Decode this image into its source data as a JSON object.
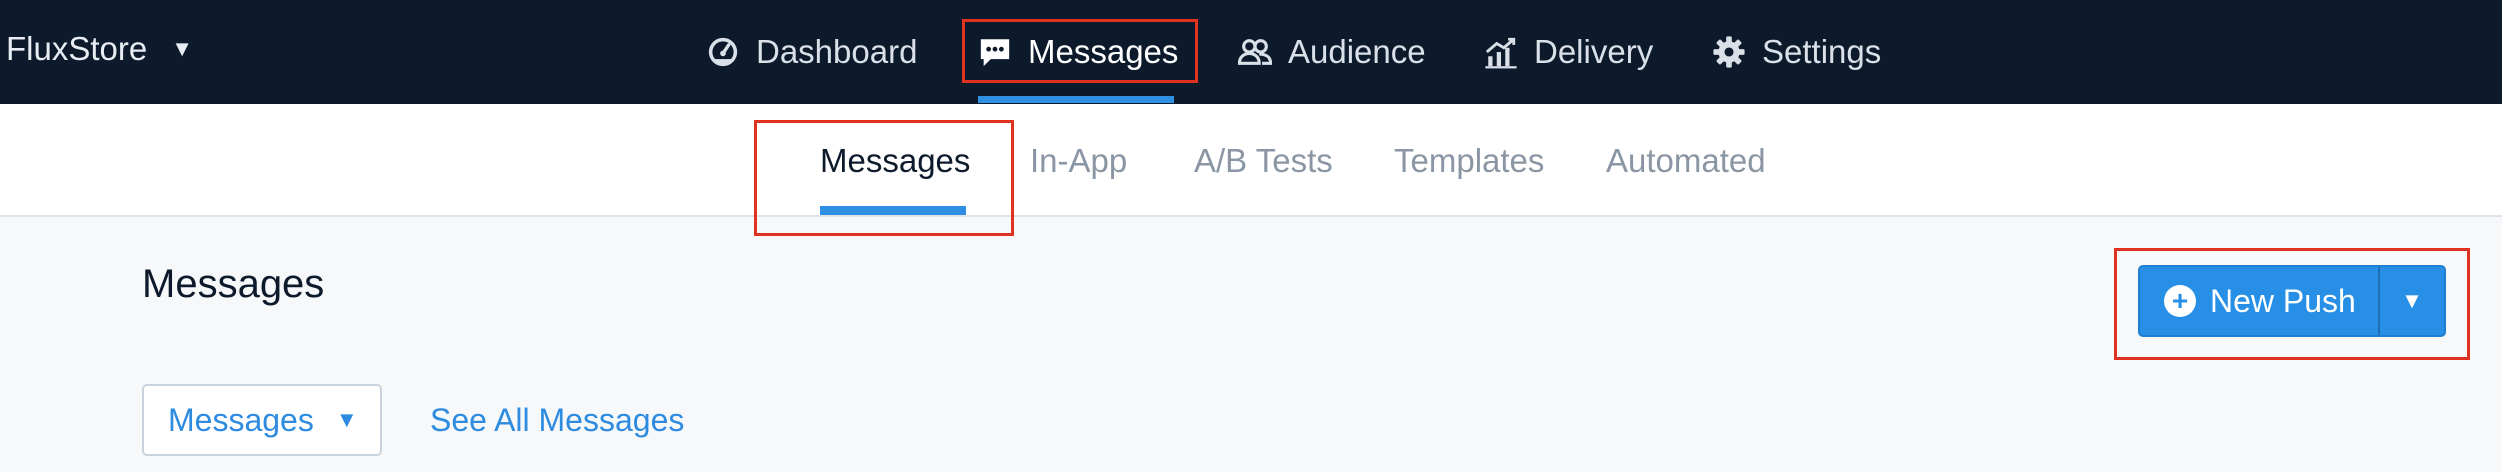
{
  "topnav": {
    "brand": "FluxStore",
    "items": [
      {
        "label": "Dashboard",
        "icon": "gauge-icon"
      },
      {
        "label": "Messages",
        "icon": "chat-icon"
      },
      {
        "label": "Audience",
        "icon": "users-icon"
      },
      {
        "label": "Delivery",
        "icon": "chart-icon"
      },
      {
        "label": "Settings",
        "icon": "gear-icon"
      }
    ],
    "active": "Messages"
  },
  "subnav": {
    "tabs": [
      "Messages",
      "In-App",
      "A/B Tests",
      "Templates",
      "Automated"
    ],
    "active": "Messages"
  },
  "main": {
    "title": "Messages",
    "new_push_label": "New Push",
    "filter_label": "Messages",
    "see_all_label": "See All Messages"
  },
  "colors": {
    "topbar": "#0c1a2c",
    "accent": "#2e8fe3",
    "annotation": "#e0321f"
  }
}
